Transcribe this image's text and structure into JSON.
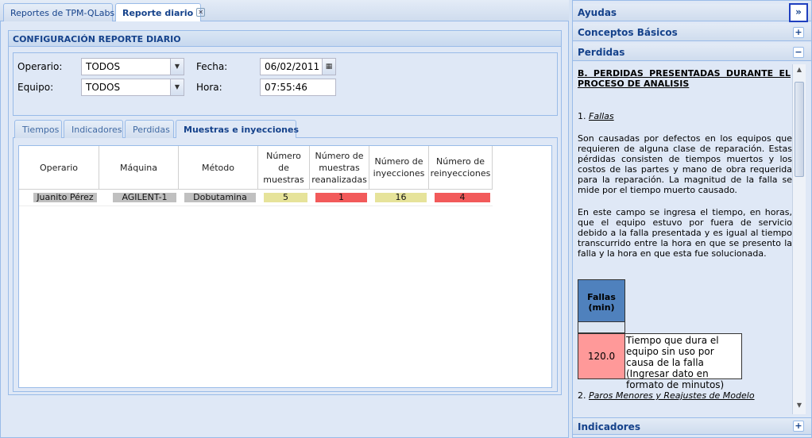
{
  "tabs": [
    {
      "label": "Reportes de TPM-QLabs"
    },
    {
      "label": "Reporte diario"
    }
  ],
  "config": {
    "title": "CONFIGURACIÓN REPORTE DIARIO",
    "operario_label": "Operario:",
    "operario_value": "TODOS",
    "equipo_label": "Equipo:",
    "equipo_value": "TODOS",
    "fecha_label": "Fecha:",
    "fecha_value": "06/02/2011",
    "hora_label": "Hora:",
    "hora_value": "07:55:46"
  },
  "inner_tabs": [
    {
      "label": "Tiempos"
    },
    {
      "label": "Indicadores"
    },
    {
      "label": "Perdidas"
    },
    {
      "label": "Muestras e inyecciones"
    }
  ],
  "grid": {
    "headers": [
      "Operario",
      "Máquina",
      "Método",
      "Número de muestras",
      "Número de muestras reanalizadas",
      "Número de inyecciones",
      "Número de reinyecciones"
    ],
    "row": {
      "operario": "Juanito Pérez",
      "maquina": "AGILENT-1",
      "metodo": "Dobutamina",
      "muestras": "5",
      "reanalizadas": "1",
      "inyecciones": "16",
      "reinyecciones": "4"
    },
    "colors": {
      "gray": "#c0c0c0",
      "yellow": "#e6e39a",
      "red": "#f25a5a"
    }
  },
  "help": {
    "panel_title": "Ayudas",
    "acc1": "Conceptos Básicos",
    "acc2": "Perdidas",
    "acc3": "Indicadores",
    "heading": "B.  PERDIDAS PRESENTADAS DURANTE EL PROCESO DE ANALISIS",
    "item1_num": "1.",
    "item1_title": "Fallas",
    "para1": "Son causadas por defectos en los equipos que requieren de alguna clase de reparación. Estas pérdidas consisten de tiempos muertos y los costos de las partes y mano de obra requerida para la reparación. La magnitud de la falla se mide por el tiempo muerto causado.",
    "para2": "En este campo se ingresa el tiempo, en horas, que el equipo estuvo por fuera de servicio debido a la falla presentada y es igual  al tiempo transcurrido entre la hora en que se presento la falla y la hora en que esta fue solucionada.",
    "table_header": "Fallas (min)",
    "table_value": "120.0",
    "table_desc": "Tiempo que dura el equipo sin uso por causa de la falla (Ingresar dato en formato de minutos)",
    "item2_num": "2.",
    "item2_title": "Paros Menores y Reajustes de Modelo"
  }
}
